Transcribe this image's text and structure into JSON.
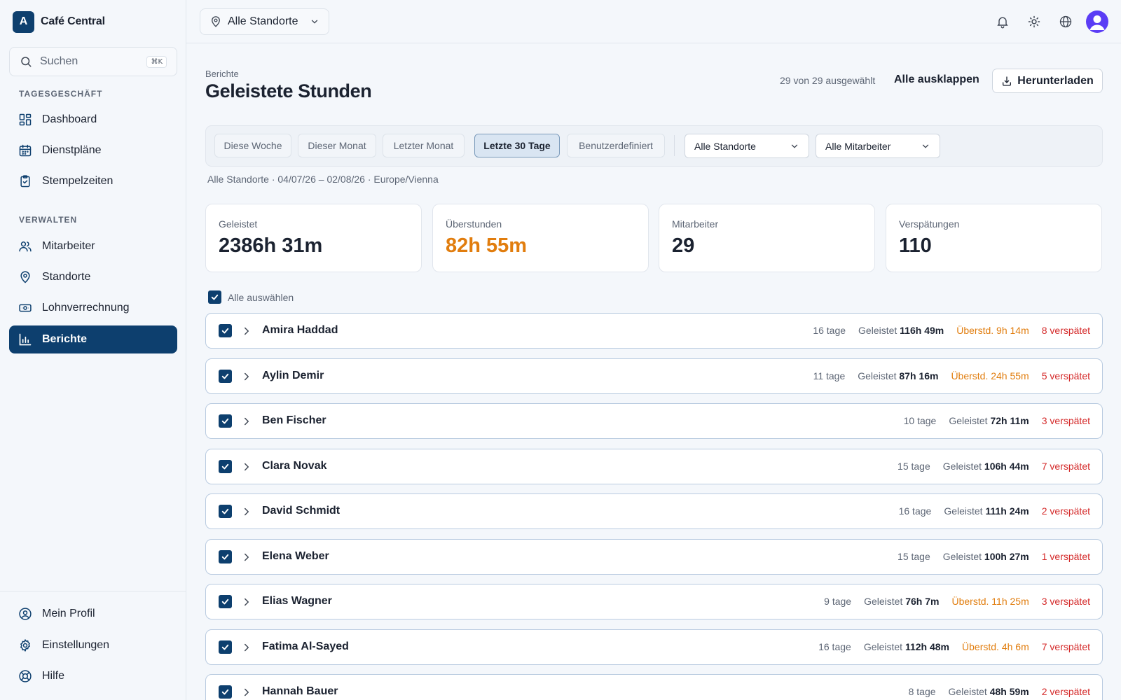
{
  "brand": {
    "logo_letter": "A",
    "name": "Café Central"
  },
  "search": {
    "placeholder": "Suchen",
    "shortcut": "⌘K"
  },
  "sidebar": {
    "section1": "TAGESGESCHÄFT",
    "section2": "VERWALTEN",
    "items": [
      {
        "label": "Dashboard",
        "icon": "dashboard-icon"
      },
      {
        "label": "Dienstpläne",
        "icon": "calendar-icon"
      },
      {
        "label": "Stempelzeiten",
        "icon": "clipboard-icon"
      },
      {
        "label": "Mitarbeiter",
        "icon": "users-icon"
      },
      {
        "label": "Standorte",
        "icon": "map-pin-icon"
      },
      {
        "label": "Lohnverrechnung",
        "icon": "banknote-icon"
      },
      {
        "label": "Berichte",
        "icon": "bar-chart-icon",
        "active": true
      }
    ],
    "bottom": [
      {
        "label": "Mein Profil",
        "icon": "user-circle-icon"
      },
      {
        "label": "Einstellungen",
        "icon": "gear-icon"
      },
      {
        "label": "Hilfe",
        "icon": "lifebuoy-icon"
      }
    ]
  },
  "topbar": {
    "location_select": "Alle Standorte"
  },
  "header": {
    "breadcrumb": "Berichte",
    "title": "Geleistete Stunden",
    "selection_count": "29 von 29 ausgewählt",
    "expand_all": "Alle ausklappen",
    "download": "Herunterladen"
  },
  "filters": {
    "ranges": [
      "Diese Woche",
      "Dieser Monat",
      "Letzter Monat",
      "Letzte 30 Tage",
      "Benutzerdefiniert"
    ],
    "active_range": "Letzte 30 Tage",
    "location_dropdown": "Alle Standorte",
    "employee_dropdown": "Alle Mitarbeiter",
    "range_info": "Alle Standorte · 04/07/26 – 02/08/26 · Europe/Vienna"
  },
  "summary": [
    {
      "label": "Geleistet",
      "value": "2386h 31m"
    },
    {
      "label": "Überstunden",
      "value": "82h 55m"
    },
    {
      "label": "Mitarbeiter",
      "value": "29"
    },
    {
      "label": "Verspätungen",
      "value": "110"
    }
  ],
  "select_all_label": "Alle auswählen",
  "worked_label": "Geleistet",
  "employees": [
    {
      "name": "Amira Haddad",
      "days": "16 tage",
      "worked": "116h 49m",
      "overtime": "Überstd. 9h 14m",
      "late": "8 verspätet"
    },
    {
      "name": "Aylin Demir",
      "days": "11 tage",
      "worked": "87h 16m",
      "overtime": "Überstd. 24h 55m",
      "late": "5 verspätet"
    },
    {
      "name": "Ben Fischer",
      "days": "10 tage",
      "worked": "72h 11m",
      "overtime": "",
      "late": "3 verspätet"
    },
    {
      "name": "Clara Novak",
      "days": "15 tage",
      "worked": "106h 44m",
      "overtime": "",
      "late": "7 verspätet"
    },
    {
      "name": "David Schmidt",
      "days": "16 tage",
      "worked": "111h 24m",
      "overtime": "",
      "late": "2 verspätet"
    },
    {
      "name": "Elena Weber",
      "days": "15 tage",
      "worked": "100h 27m",
      "overtime": "",
      "late": "1 verspätet"
    },
    {
      "name": "Elias Wagner",
      "days": "9 tage",
      "worked": "76h 7m",
      "overtime": "Überstd. 11h 25m",
      "late": "3 verspätet"
    },
    {
      "name": "Fatima Al-Sayed",
      "days": "16 tage",
      "worked": "112h 48m",
      "overtime": "Überstd. 4h 6m",
      "late": "7 verspätet"
    },
    {
      "name": "Hannah Bauer",
      "days": "8 tage",
      "worked": "48h 59m",
      "overtime": "",
      "late": "2 verspätet"
    }
  ],
  "colors": {
    "brand": "#0d3f6e",
    "overtime": "#e17d0e",
    "late": "#d42a2a",
    "avatar": "#5b3df5"
  }
}
